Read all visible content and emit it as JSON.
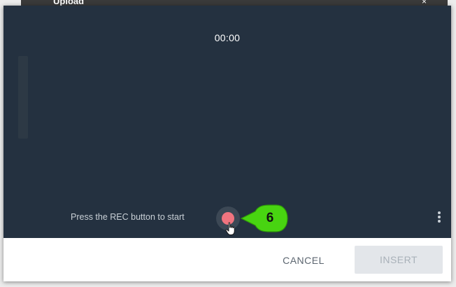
{
  "background": {
    "title": "Upload",
    "close_glyph": "×"
  },
  "recorder": {
    "timer": "00:00",
    "hint": "Press the REC button to start",
    "rec_button": "record-icon",
    "more_menu": "more-vertical-icon",
    "callout_number": "6",
    "colors": {
      "panel": "#243140",
      "rec_dot": "#f0747f",
      "callout": "#48d411"
    }
  },
  "footer": {
    "cancel_label": "CANCEL",
    "insert_label": "INSERT"
  }
}
